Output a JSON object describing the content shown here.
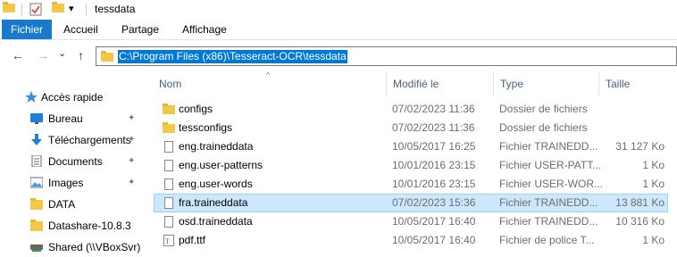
{
  "window": {
    "title": "tessdata"
  },
  "quick_access_toolbar": {
    "dropdown_glyph": "▾"
  },
  "ribbon": {
    "file_tab": "Fichier",
    "tabs": [
      "Accueil",
      "Partage",
      "Affichage"
    ]
  },
  "navigation": {
    "back_glyph": "←",
    "forward_glyph": "→",
    "recent_glyph": "⌄",
    "up_glyph": "↑",
    "address": "C:\\Program Files (x86)\\Tesseract-OCR\\tessdata"
  },
  "sidebar": {
    "items": [
      {
        "label": "Accès rapide",
        "icon": "star-icon",
        "pinned": false
      },
      {
        "label": "Bureau",
        "icon": "desktop-icon",
        "pinned": true
      },
      {
        "label": "Téléchargements",
        "icon": "download-icon",
        "pinned": true
      },
      {
        "label": "Documents",
        "icon": "documents-icon",
        "pinned": true
      },
      {
        "label": "Images",
        "icon": "images-icon",
        "pinned": true
      },
      {
        "label": "DATA",
        "icon": "folder-icon",
        "pinned": false
      },
      {
        "label": "Datashare-10.8.3",
        "icon": "folder-icon",
        "pinned": false
      },
      {
        "label": "Shared (\\\\VBoxSvr)",
        "icon": "network-drive-icon",
        "pinned": false
      }
    ],
    "pin_glyph": "📌"
  },
  "columns": {
    "name": "Nom",
    "modified": "Modifié le",
    "type": "Type",
    "size": "Taille",
    "sort_glyph": "^"
  },
  "files": [
    {
      "name": "configs",
      "modified": "07/02/2023 11:36",
      "type": "Dossier de fichiers",
      "size": "",
      "kind": "folder",
      "selected": false
    },
    {
      "name": "tessconfigs",
      "modified": "07/02/2023 11:36",
      "type": "Dossier de fichiers",
      "size": "",
      "kind": "folder",
      "selected": false
    },
    {
      "name": "eng.traineddata",
      "modified": "10/05/2017 16:25",
      "type": "Fichier TRAINEDD...",
      "size": "31 127 Ko",
      "kind": "file",
      "selected": false
    },
    {
      "name": "eng.user-patterns",
      "modified": "10/01/2016 23:15",
      "type": "Fichier USER-PATT...",
      "size": "1 Ko",
      "kind": "file",
      "selected": false
    },
    {
      "name": "eng.user-words",
      "modified": "10/01/2016 23:15",
      "type": "Fichier USER-WOR...",
      "size": "1 Ko",
      "kind": "file",
      "selected": false
    },
    {
      "name": "fra.traineddata",
      "modified": "07/02/2023 15:36",
      "type": "Fichier TRAINEDD...",
      "size": "13 881 Ko",
      "kind": "file",
      "selected": true
    },
    {
      "name": "osd.traineddata",
      "modified": "10/05/2017 16:40",
      "type": "Fichier TRAINEDD...",
      "size": "10 316 Ko",
      "kind": "file",
      "selected": false
    },
    {
      "name": "pdf.ttf",
      "modified": "10/05/2017 16:40",
      "type": "Fichier de police T...",
      "size": "1 Ko",
      "kind": "font",
      "selected": false
    }
  ],
  "colors": {
    "accent": "#1979ca",
    "folder": "#f3c84a",
    "selection_bg": "#cce8ff",
    "selection_border": "#99d1ff",
    "address_highlight": "#0078d7"
  }
}
